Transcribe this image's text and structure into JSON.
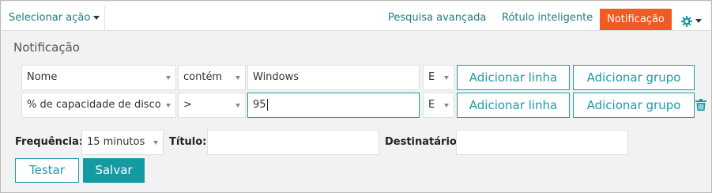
{
  "topbar": {
    "select_action": "Selecionar ação",
    "advanced_search": "Pesquisa avançada",
    "smart_label": "Rótulo inteligente",
    "notification": "Notificação",
    "settings_icon": "gear-icon"
  },
  "panel": {
    "title": "Notificação"
  },
  "rules": [
    {
      "field": "Nome",
      "operator": "contém",
      "value": "Windows",
      "conjunction": "E",
      "add_row": "Adicionar linha",
      "add_group": "Adicionar grupo"
    },
    {
      "field": "% de capacidade de disco",
      "operator": ">",
      "value": "95",
      "conjunction": "E",
      "add_row": "Adicionar linha",
      "add_group": "Adicionar grupo"
    }
  ],
  "settings": {
    "frequency_label": "Frequência:",
    "frequency_value": "15 minutos",
    "title_label": "Título:",
    "title_value": "",
    "recipient_label": "Destinatário:",
    "recipient_value": ""
  },
  "actions": {
    "test": "Testar",
    "save": "Salvar"
  },
  "colors": {
    "accent": "#1f9aa8",
    "active_tab": "#f15a22",
    "primary_button": "#149aa3"
  }
}
